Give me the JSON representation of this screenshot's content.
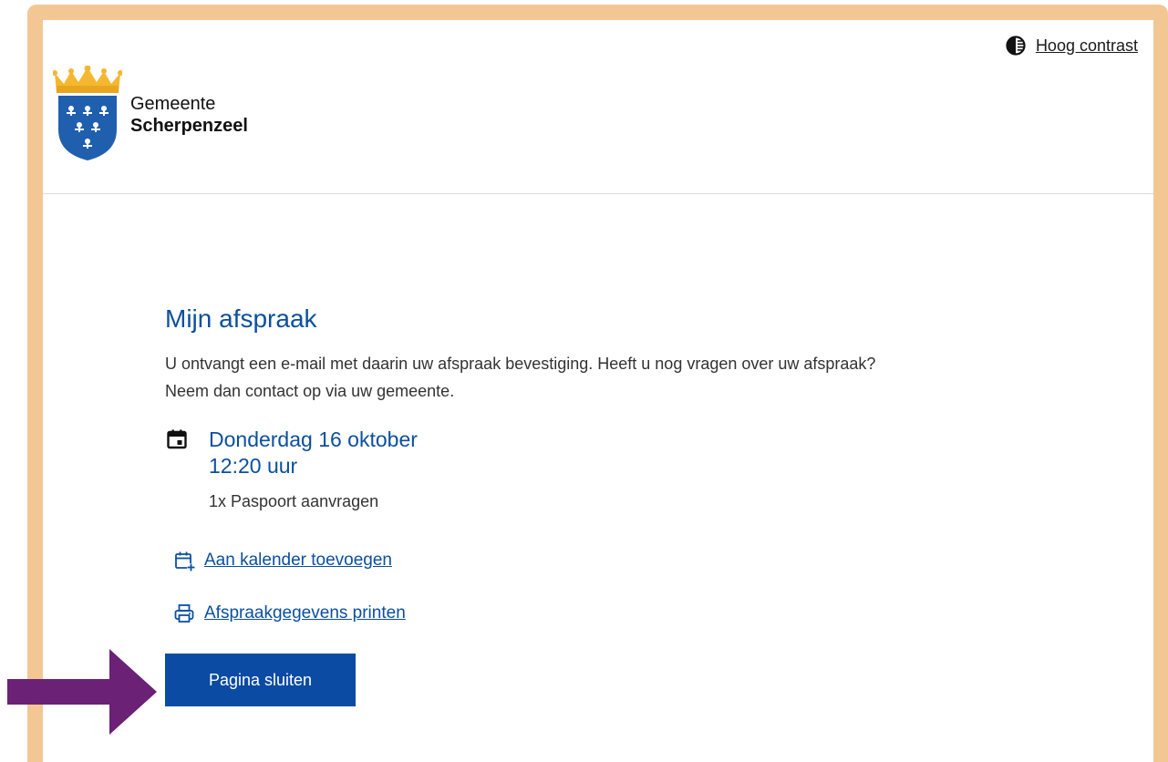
{
  "colors": {
    "frame": "#f3c793",
    "primary": "#0b4ba3",
    "heading": "#0b4fa0",
    "crest_gold": "#f6b730",
    "crest_blue": "#1f5fae",
    "arrow": "#6a2176"
  },
  "header": {
    "contrast_label": "Hoog contrast",
    "contrast_icon": "contrast-icon",
    "logo": {
      "line1": "Gemeente",
      "line2": "Scherpenzeel"
    }
  },
  "appointment": {
    "title": "Mijn afspraak",
    "intro_line1": "U ontvangt een e-mail met daarin uw afspraak bevestiging. Heeft u nog vragen over uw afspraak?",
    "intro_line2": "Neem dan contact op via uw gemeente.",
    "date": "Donderdag 16 oktober",
    "time": "12:20 uur",
    "service": "1x Paspoort aanvragen",
    "icon": "calendar-icon"
  },
  "actions": {
    "add_calendar": "Aan kalender toevoegen",
    "add_calendar_icon": "calendar-add-icon",
    "print": "Afspraakgegevens printen",
    "print_icon": "printer-icon",
    "close": "Pagina sluiten"
  }
}
